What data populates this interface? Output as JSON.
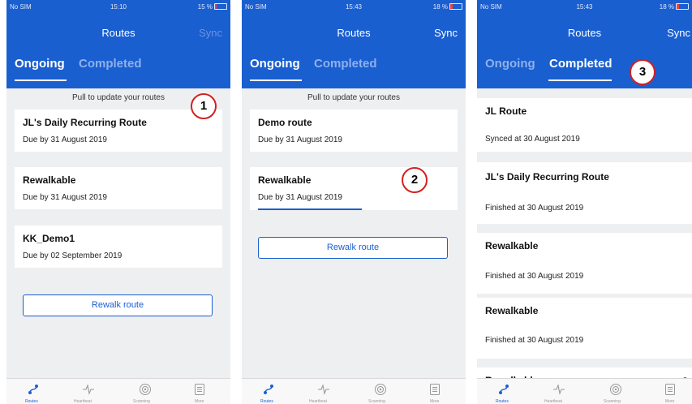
{
  "screens": [
    {
      "status": {
        "carrier": "No SIM",
        "time": "15:10",
        "battery": "15 %",
        "battery_fill": 0.15
      },
      "nav": {
        "title": "Routes",
        "sync": "Sync"
      },
      "tabs": {
        "ongoing": "Ongoing",
        "completed": "Completed"
      },
      "hint": "Pull to update your routes",
      "routes": [
        {
          "name": "JL's Daily Recurring Route",
          "due": "Due by 31 August 2019"
        },
        {
          "name": "Rewalkable",
          "due": "Due by 31 August 2019"
        },
        {
          "name": "KK_Demo1",
          "due": "Due by 02 September 2019"
        }
      ],
      "rewalk_button": "Rewalk route",
      "callout": "1"
    },
    {
      "status": {
        "carrier": "No SIM",
        "time": "15:43",
        "battery": "18 %",
        "battery_fill": 0.18
      },
      "nav": {
        "title": "Routes",
        "sync": "Sync"
      },
      "tabs": {
        "ongoing": "Ongoing",
        "completed": "Completed"
      },
      "hint": "Pull to update your routes",
      "routes": [
        {
          "name": "Demo route",
          "due": "Due by 31 August 2019"
        },
        {
          "name": "Rewalkable",
          "due": "Due by 31 August 2019",
          "progress": 0.5
        }
      ],
      "rewalk_button": "Rewalk route",
      "callout": "2"
    },
    {
      "status": {
        "carrier": "No SIM",
        "time": "15:43",
        "battery": "18 %",
        "battery_fill": 0.18
      },
      "nav": {
        "title": "Routes",
        "sync": "Sync"
      },
      "tabs": {
        "ongoing": "Ongoing",
        "completed": "Completed"
      },
      "completed": [
        {
          "name": "JL Route",
          "status": "Synced at 30 August 2019"
        },
        {
          "name": "JL's Daily Recurring Route",
          "status": "Finished at 30 August 2019"
        },
        {
          "name": "Rewalkable",
          "status": "Finished at 30 August 2019"
        },
        {
          "name": "Rewalkable",
          "status": "Finished at 30 August 2019"
        },
        {
          "name": "Rewalkable",
          "status": ""
        }
      ],
      "callout": "3"
    }
  ],
  "tabbar": {
    "items": [
      {
        "label": "Routes",
        "icon": "routes-icon"
      },
      {
        "label": "Heartbeat",
        "icon": "heartbeat-icon"
      },
      {
        "label": "Scanning",
        "icon": "scan-icon"
      },
      {
        "label": "More",
        "icon": "menu-icon"
      }
    ]
  },
  "colors": {
    "brand": "#1a5fd0",
    "callout": "#d42020",
    "background": "#eeeff1"
  }
}
